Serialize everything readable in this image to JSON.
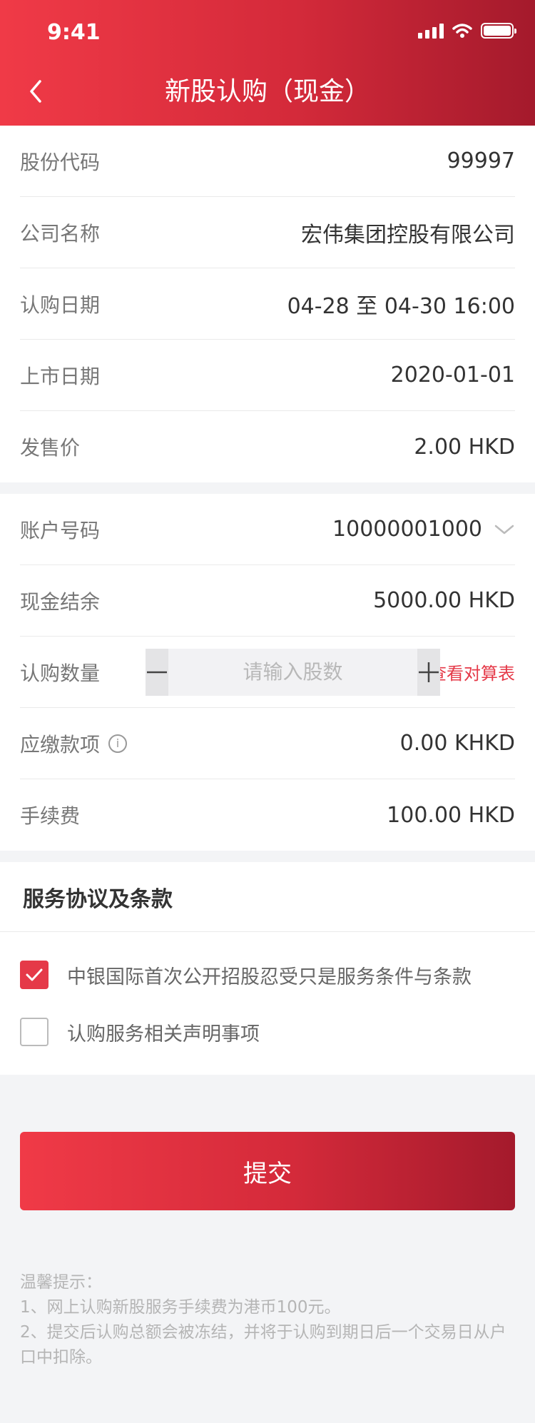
{
  "status_bar": {
    "time": "9:41"
  },
  "header": {
    "title": "新股认购（现金）"
  },
  "stock_info": {
    "rows": [
      {
        "label": "股份代码",
        "value": "99997"
      },
      {
        "label": "公司名称",
        "value": "宏伟集团控股有限公司"
      },
      {
        "label": "认购日期",
        "value": "04-28 至 04-30 16:00"
      },
      {
        "label": "上市日期",
        "value": "2020-01-01"
      },
      {
        "label": "发售价",
        "value": "2.00 HKD"
      }
    ]
  },
  "account": {
    "account_label": "账户号码",
    "account_value": "10000001000",
    "cash_label": "现金结余",
    "cash_value": "5000.00 HKD",
    "quantity_label": "认购数量",
    "quantity_placeholder": "请输入股数",
    "calc_link": "查看对算表",
    "payable_label": "应缴款项",
    "payable_value": "0.00 KHKD",
    "fee_label": "手续费",
    "fee_value": "100.00 HKD"
  },
  "agreement": {
    "title": "服务协议及条款",
    "items": [
      {
        "label": "中银国际首次公开招股忍受只是服务条件与条款",
        "checked": true
      },
      {
        "label": "认购服务相关声明事项",
        "checked": false
      }
    ]
  },
  "submit_label": "提交",
  "tips": {
    "title": "温馨提示：",
    "lines": [
      "1、网上认购新股服务手续费为港币100元。",
      "2、提交后认购总额会被冻结，并将于认购到期日后一个交易日从户口中扣除。"
    ]
  },
  "colors": {
    "accent": "#e53948",
    "header_start": "#f03a47",
    "header_end": "#a41a2c"
  }
}
